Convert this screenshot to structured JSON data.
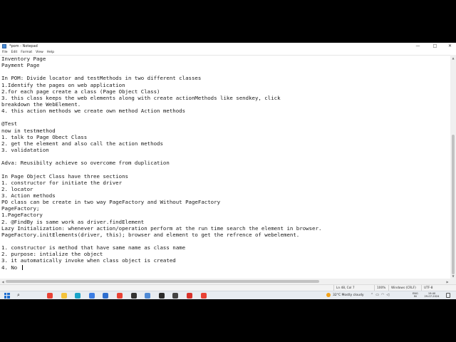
{
  "window": {
    "title": "*pom - Notepad",
    "controls": {
      "minimize": "—",
      "maximize": "□",
      "close": "✕"
    }
  },
  "menu": [
    "File",
    "Edit",
    "Format",
    "View",
    "Help"
  ],
  "editor": {
    "lines": [
      "Inventory Page",
      "Payment Page",
      "",
      "In POM: Divide locator and testMethods in two different classes",
      "1.Identify the pages on web application",
      "2.for each page create a class (Page Object Class)",
      "3. this class keeps the web elements along with create actionMethods like sendkey, click",
      "breakdown the WebElement.",
      "4. this action methods we create own method Action methods",
      "",
      "@Test",
      "now in testmethod",
      "1. talk to Page Obect Class",
      "2. get the element and also call the action methods",
      "3. validatation",
      "",
      "Adva: Reusibilty achieve so overcome from duplication",
      "",
      "In Page Object Class have three sections",
      "1. constructor for initiate the driver",
      "2. locator",
      "3. Action methods",
      "PO class can be create in two way PageFactory and Without PageFactory",
      "PageFactory;",
      "1.PageFactory",
      "2. @FindBy is same work as driver.findElement",
      "Lazy Initialization: whenever action/operation perform at the run time search the element in browser.",
      "PageFactory.initElements(driver, this); browser and element to get the refrence of webelement.",
      "",
      "1. constructor is method that have same name as class name",
      "2. purpose: intialize the object",
      "3. it automatically invoke when class object is created",
      "4. No "
    ]
  },
  "status": {
    "position": "Ln 48, Col 7",
    "zoom": "100%",
    "line_endings": "Windows (CRLF)",
    "encoding": "UTF-8"
  },
  "taskbar": {
    "weather": "32°C  Mostly cloudy",
    "lang_top": "ENG",
    "lang_bottom": "IN",
    "time": "19:40",
    "date": "29-07-2024",
    "apps": [
      {
        "name": "chrome-icon",
        "color": "#e94235"
      },
      {
        "name": "folder-icon",
        "color": "#f4c23b"
      },
      {
        "name": "edge-icon",
        "color": "#1aa3c8"
      },
      {
        "name": "photos-icon",
        "color": "#3b7de3"
      },
      {
        "name": "mail-icon",
        "color": "#2f6fcf"
      },
      {
        "name": "chrome-icon-2",
        "color": "#e94235"
      },
      {
        "name": "app-icon",
        "color": "#333333"
      },
      {
        "name": "notepad-icon",
        "color": "#4f8ad6"
      },
      {
        "name": "obs-icon",
        "color": "#2b2b2b"
      },
      {
        "name": "media-icon",
        "color": "#444444"
      },
      {
        "name": "settings-icon",
        "color": "#d8322b"
      },
      {
        "name": "chrome-icon-3",
        "color": "#e94235"
      }
    ]
  }
}
